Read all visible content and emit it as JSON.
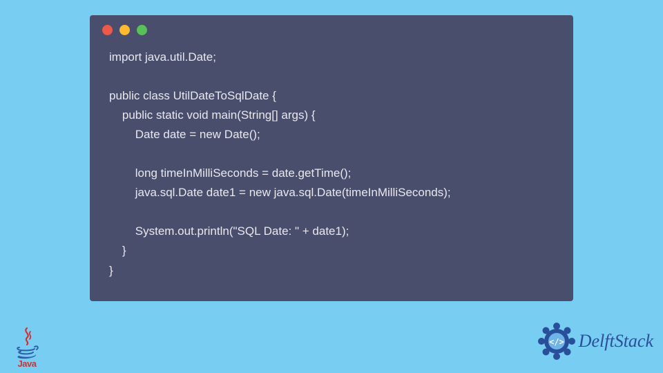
{
  "window": {
    "dots": [
      "close",
      "minimize",
      "zoom"
    ]
  },
  "code": {
    "lines": [
      "import java.util.Date;",
      "",
      "public class UtilDateToSqlDate {",
      "    public static void main(String[] args) {",
      "        Date date = new Date();",
      "",
      "        long timeInMilliSeconds = date.getTime();",
      "        java.sql.Date date1 = new java.sql.Date(timeInMilliSeconds);",
      "",
      "        System.out.println(\"SQL Date: \" + date1);",
      "    }",
      "}"
    ]
  },
  "logos": {
    "java_label": "Java",
    "delft_label": "DelftStack"
  },
  "colors": {
    "page_bg": "#78cdf2",
    "window_bg": "#4a4e6d",
    "code_fg": "#e8e8ee",
    "delft_blue": "#294e9a"
  }
}
